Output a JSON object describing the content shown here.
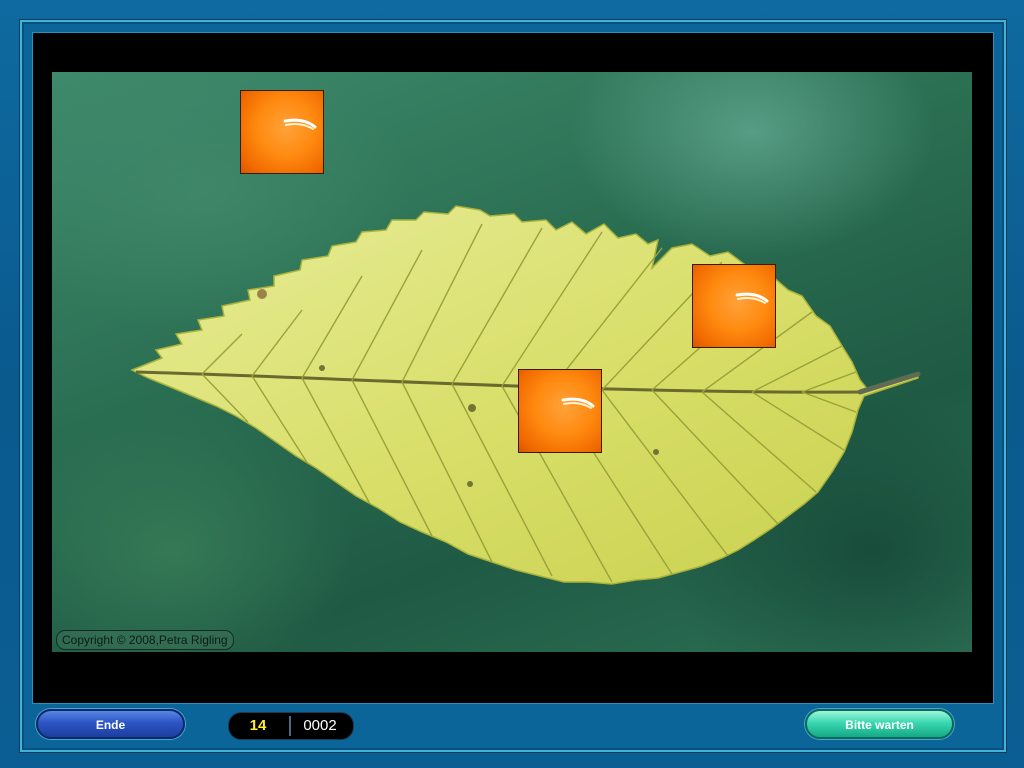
{
  "game": {
    "copyright": "Copyright © 2008,Petra Rigling",
    "tiles_remaining_count": 3
  },
  "toolbar": {
    "end_label": "Ende",
    "wait_label": "Bitte warten",
    "counter_left": "14",
    "counter_right": "0002"
  },
  "colors": {
    "frame": "#0b5e93",
    "tile": "#ff8a10",
    "end_button": "#2c55c4",
    "wait_button": "#39d8b0",
    "counter_left_text": "#ffee33"
  },
  "icons": {
    "tile": "orange-cover-tile",
    "photo": "leaf-photo"
  }
}
